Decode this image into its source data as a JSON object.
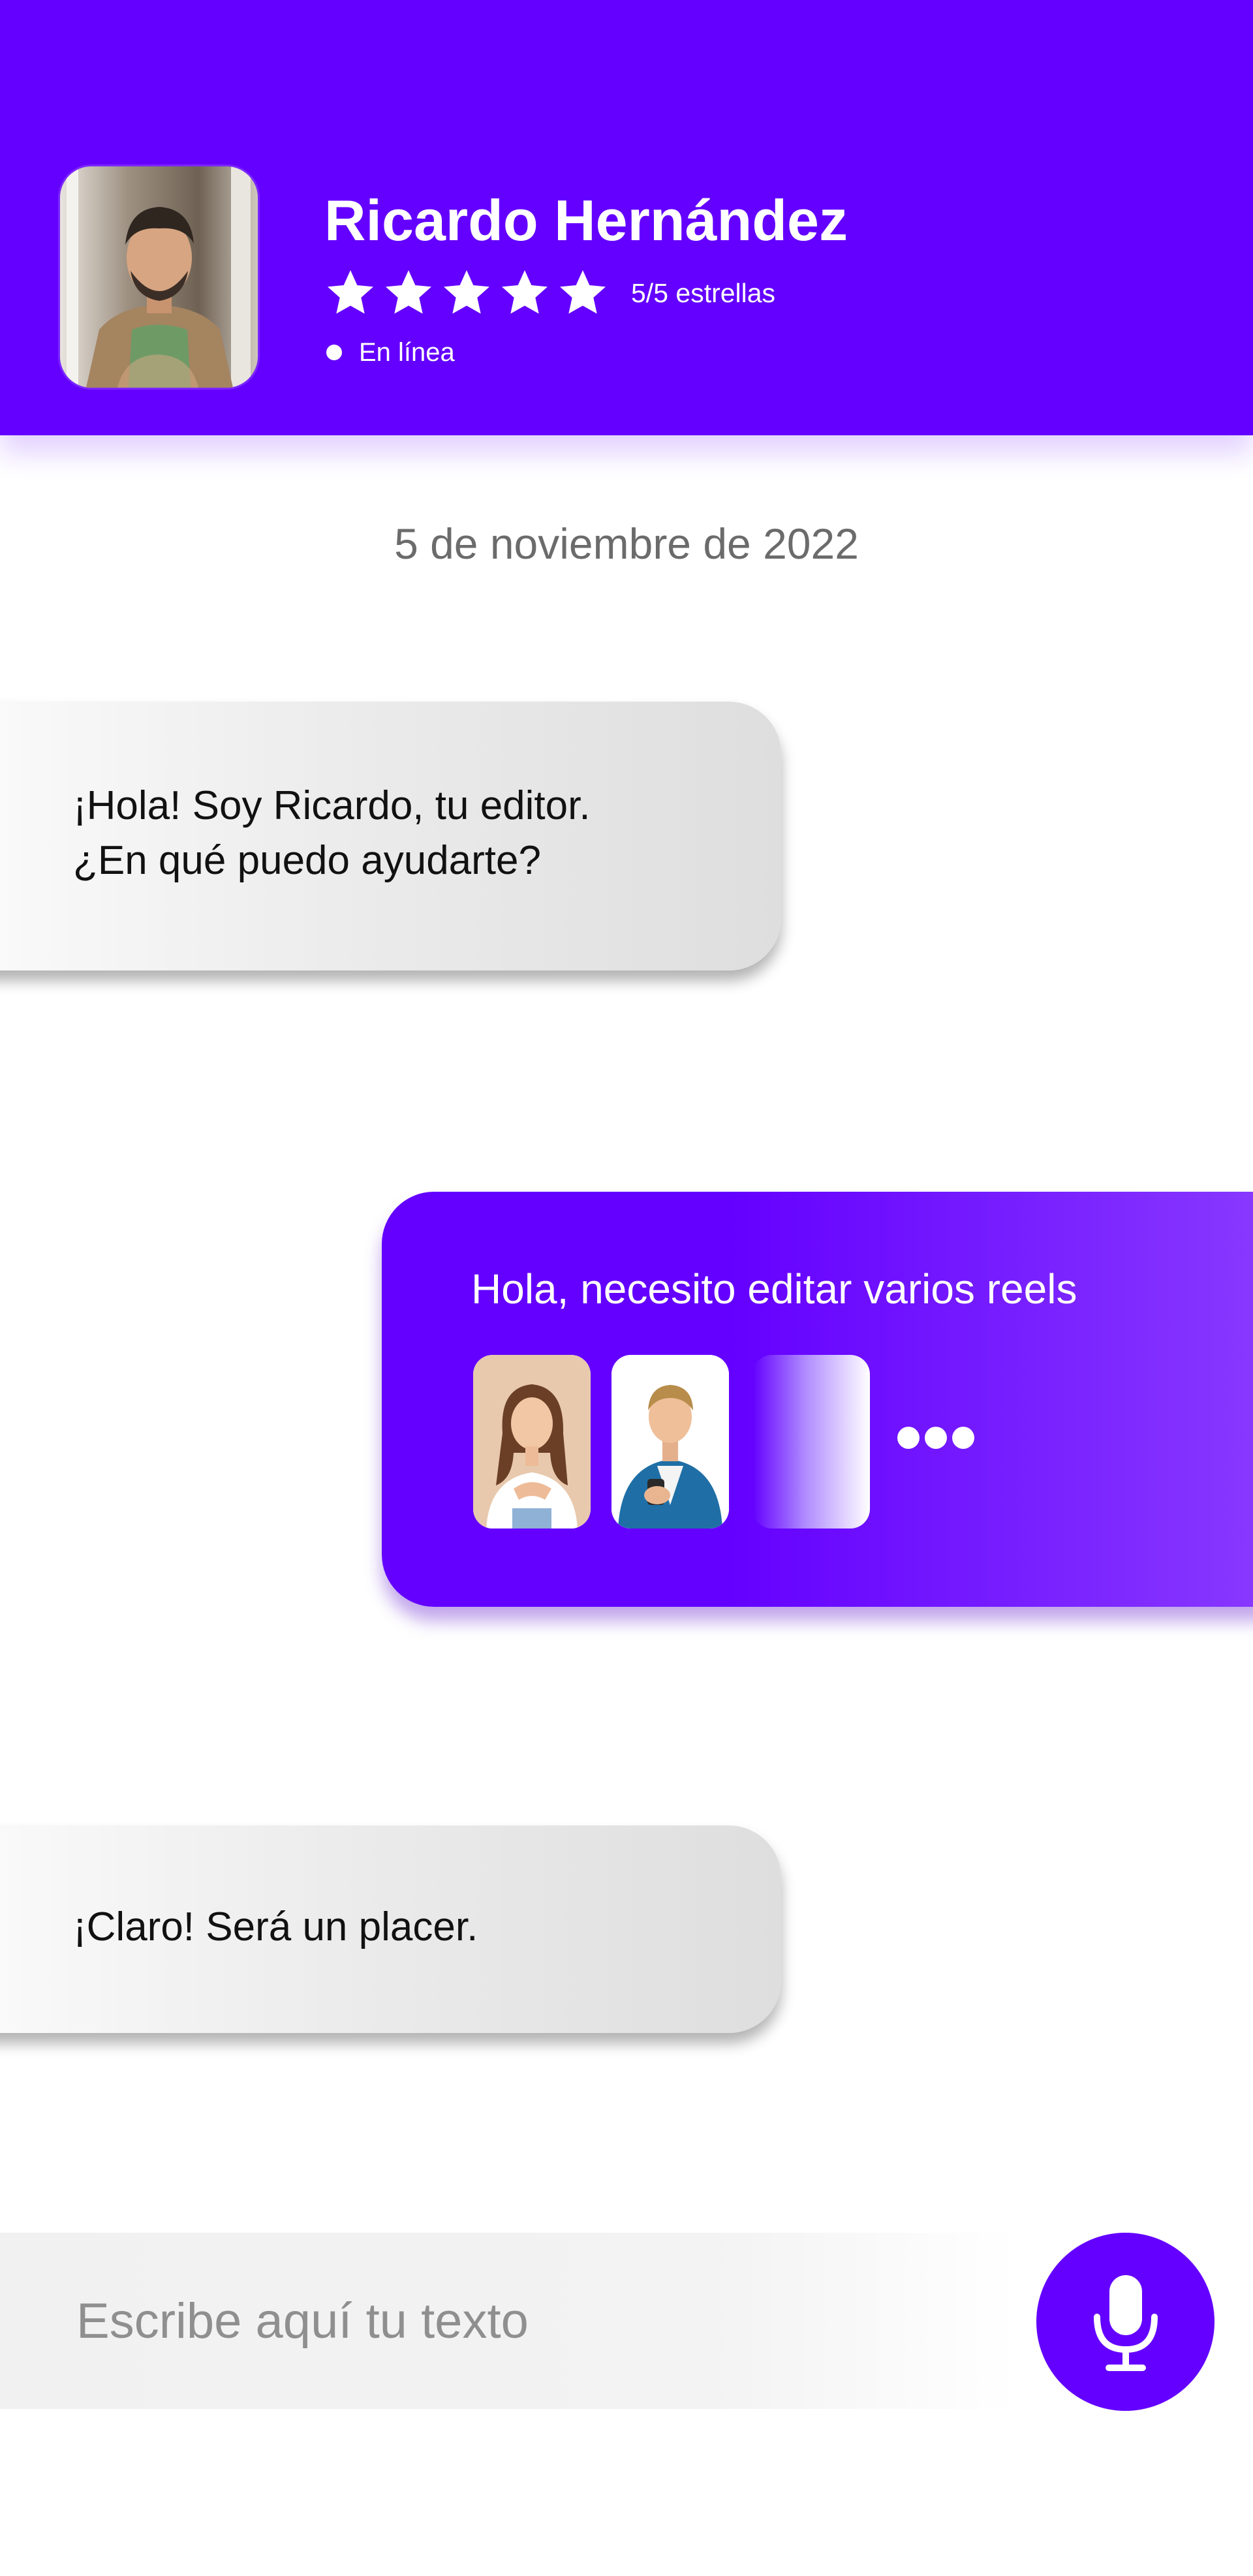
{
  "colors": {
    "primary": "#6400FF",
    "bubble_incoming": "#e6e6e6",
    "text_dark": "#111111",
    "text_muted": "#6b6b6b"
  },
  "header": {
    "contact_name": "Ricardo Hernández",
    "rating": {
      "value": 5,
      "max": 5,
      "label": "5/5 estrellas"
    },
    "status": "En línea",
    "avatar_icon": "person-photo"
  },
  "chat": {
    "date": "5 de noviembre de 2022",
    "messages": [
      {
        "sender": "contact",
        "text": "¡Hola! Soy Ricardo, tu editor.\n¿En qué puedo ayudarte?"
      },
      {
        "sender": "user",
        "text": "Hola, necesito editar varios reels",
        "attachments": [
          "woman-photo",
          "man-photo",
          "faded-photo"
        ],
        "more_icon": "more-dots-icon"
      },
      {
        "sender": "contact",
        "text": "¡Claro! Será un placer."
      }
    ]
  },
  "composer": {
    "placeholder": "Escribe aquí tu texto",
    "value": "",
    "mic_icon": "microphone-icon"
  }
}
